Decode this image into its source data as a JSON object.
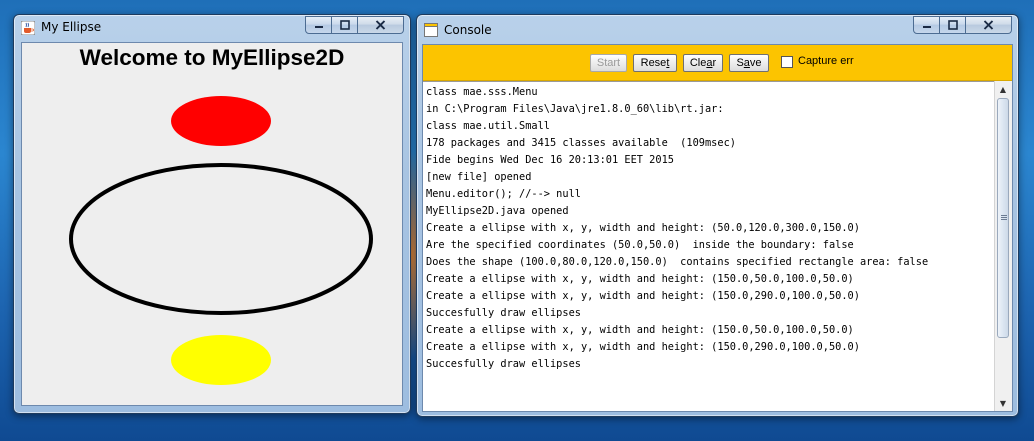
{
  "ellipse_window": {
    "title": "My Ellipse",
    "heading": "Welcome to MyEllipse2D",
    "shapes": [
      {
        "name": "red-ellipse",
        "fill": "#ff0000"
      },
      {
        "name": "black-ellipse-outline",
        "stroke": "#000000"
      },
      {
        "name": "yellow-ellipse",
        "fill": "#ffff00"
      }
    ]
  },
  "console_window": {
    "title": "Console",
    "buttons": {
      "start": "Start",
      "reset": "Reset",
      "clear": "Clear",
      "save": "Save"
    },
    "capture_label": "Capture err",
    "capture_checked": false,
    "lines": [
      "class mae.sss.Menu",
      "in C:\\Program Files\\Java\\jre1.8.0_60\\lib\\rt.jar:",
      "class mae.util.Small",
      "178 packages and 3415 classes available  (109msec)",
      "Fide begins Wed Dec 16 20:13:01 EET 2015",
      "[new file] opened",
      "Menu.editor(); //--> null",
      "MyEllipse2D.java opened",
      "Create a ellipse with x, y, width and height: (50.0,120.0,300.0,150.0)",
      "Are the specified coordinates (50.0,50.0)  inside the boundary: false",
      "Does the shape (100.0,80.0,120.0,150.0)  contains specified rectangle area: false",
      "Create a ellipse with x, y, width and height: (150.0,50.0,100.0,50.0)",
      "Create a ellipse with x, y, width and height: (150.0,290.0,100.0,50.0)",
      "Succesfully draw ellipses",
      "Create a ellipse with x, y, width and height: (150.0,50.0,100.0,50.0)",
      "Create a ellipse with x, y, width and height: (150.0,290.0,100.0,50.0)",
      "Succesfully draw ellipses"
    ]
  },
  "colors": {
    "toolbar": "#fcc400",
    "ellipse_red": "#ff0000",
    "ellipse_yellow": "#ffff00"
  }
}
